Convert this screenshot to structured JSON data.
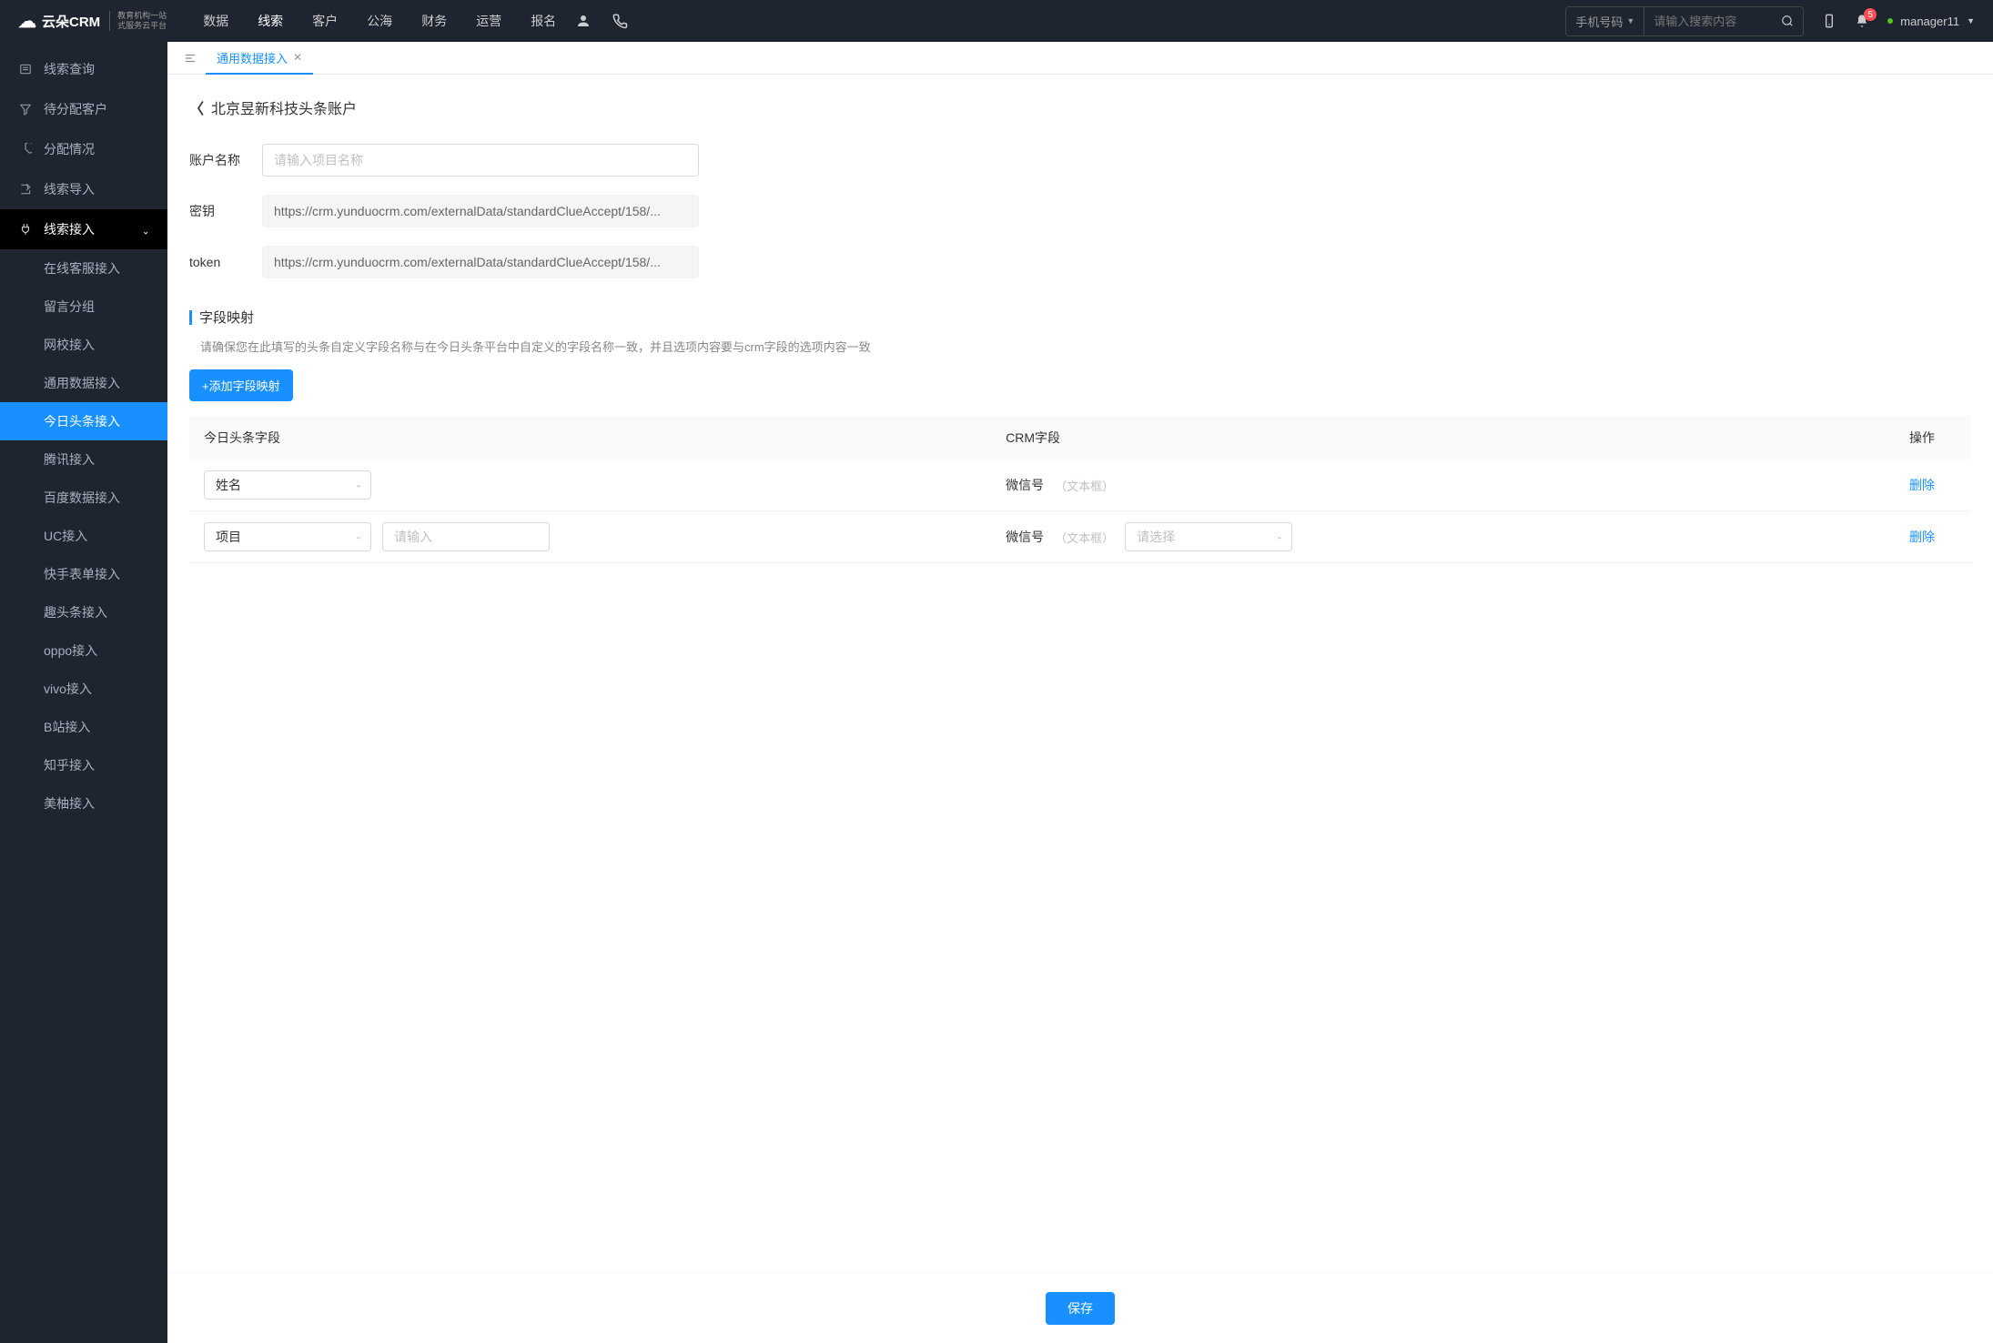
{
  "header": {
    "logo": "云朵CRM",
    "logo_sub1": "教育机构一站",
    "logo_sub2": "式服务云平台",
    "nav": [
      "数据",
      "线索",
      "客户",
      "公海",
      "财务",
      "运营",
      "报名"
    ],
    "nav_active": 1,
    "search_prefix": "手机号码",
    "search_placeholder": "请输入搜索内容",
    "badge_count": "5",
    "username": "manager11"
  },
  "sidebar": {
    "items": [
      {
        "label": "线索查询",
        "icon": "list"
      },
      {
        "label": "待分配客户",
        "icon": "filter"
      },
      {
        "label": "分配情况",
        "icon": "pie"
      },
      {
        "label": "线索导入",
        "icon": "export"
      },
      {
        "label": "线索接入",
        "icon": "plug",
        "expanded": true,
        "children": [
          "在线客服接入",
          "留言分组",
          "网校接入",
          "通用数据接入",
          "今日头条接入",
          "腾讯接入",
          "百度数据接入",
          "UC接入",
          "快手表单接入",
          "趣头条接入",
          "oppo接入",
          "vivo接入",
          "B站接入",
          "知乎接入",
          "美柚接入"
        ],
        "active_child": 4
      }
    ]
  },
  "tabs": [
    {
      "label": "通用数据接入",
      "active": true
    }
  ],
  "breadcrumb": "北京昱新科技头条账户",
  "form": {
    "account_label": "账户名称",
    "account_placeholder": "请输入项目名称",
    "secret_label": "密钥",
    "secret_value": "https://crm.yunduocrm.com/externalData/standardClueAccept/158/...",
    "token_label": "token",
    "token_value": "https://crm.yunduocrm.com/externalData/standardClueAccept/158/..."
  },
  "mapping": {
    "title": "字段映射",
    "hint": "请确保您在此填写的头条自定义字段名称与在今日头条平台中自定义的字段名称一致，并且选项内容要与crm字段的选项内容一致",
    "add_btn": "+添加字段映射",
    "cols": {
      "source": "今日头条字段",
      "crm": "CRM字段",
      "action": "操作"
    },
    "rows": [
      {
        "source_select": "姓名",
        "crm_label": "微信号",
        "crm_type": "（文本框）",
        "has_input": false,
        "has_crm_select": false
      },
      {
        "source_select": "项目",
        "input_placeholder": "请输入",
        "crm_label": "微信号",
        "crm_type": "（文本框）",
        "crm_select_placeholder": "请选择",
        "has_input": true,
        "has_crm_select": true
      }
    ],
    "delete_label": "删除"
  },
  "footer": {
    "save": "保存"
  }
}
